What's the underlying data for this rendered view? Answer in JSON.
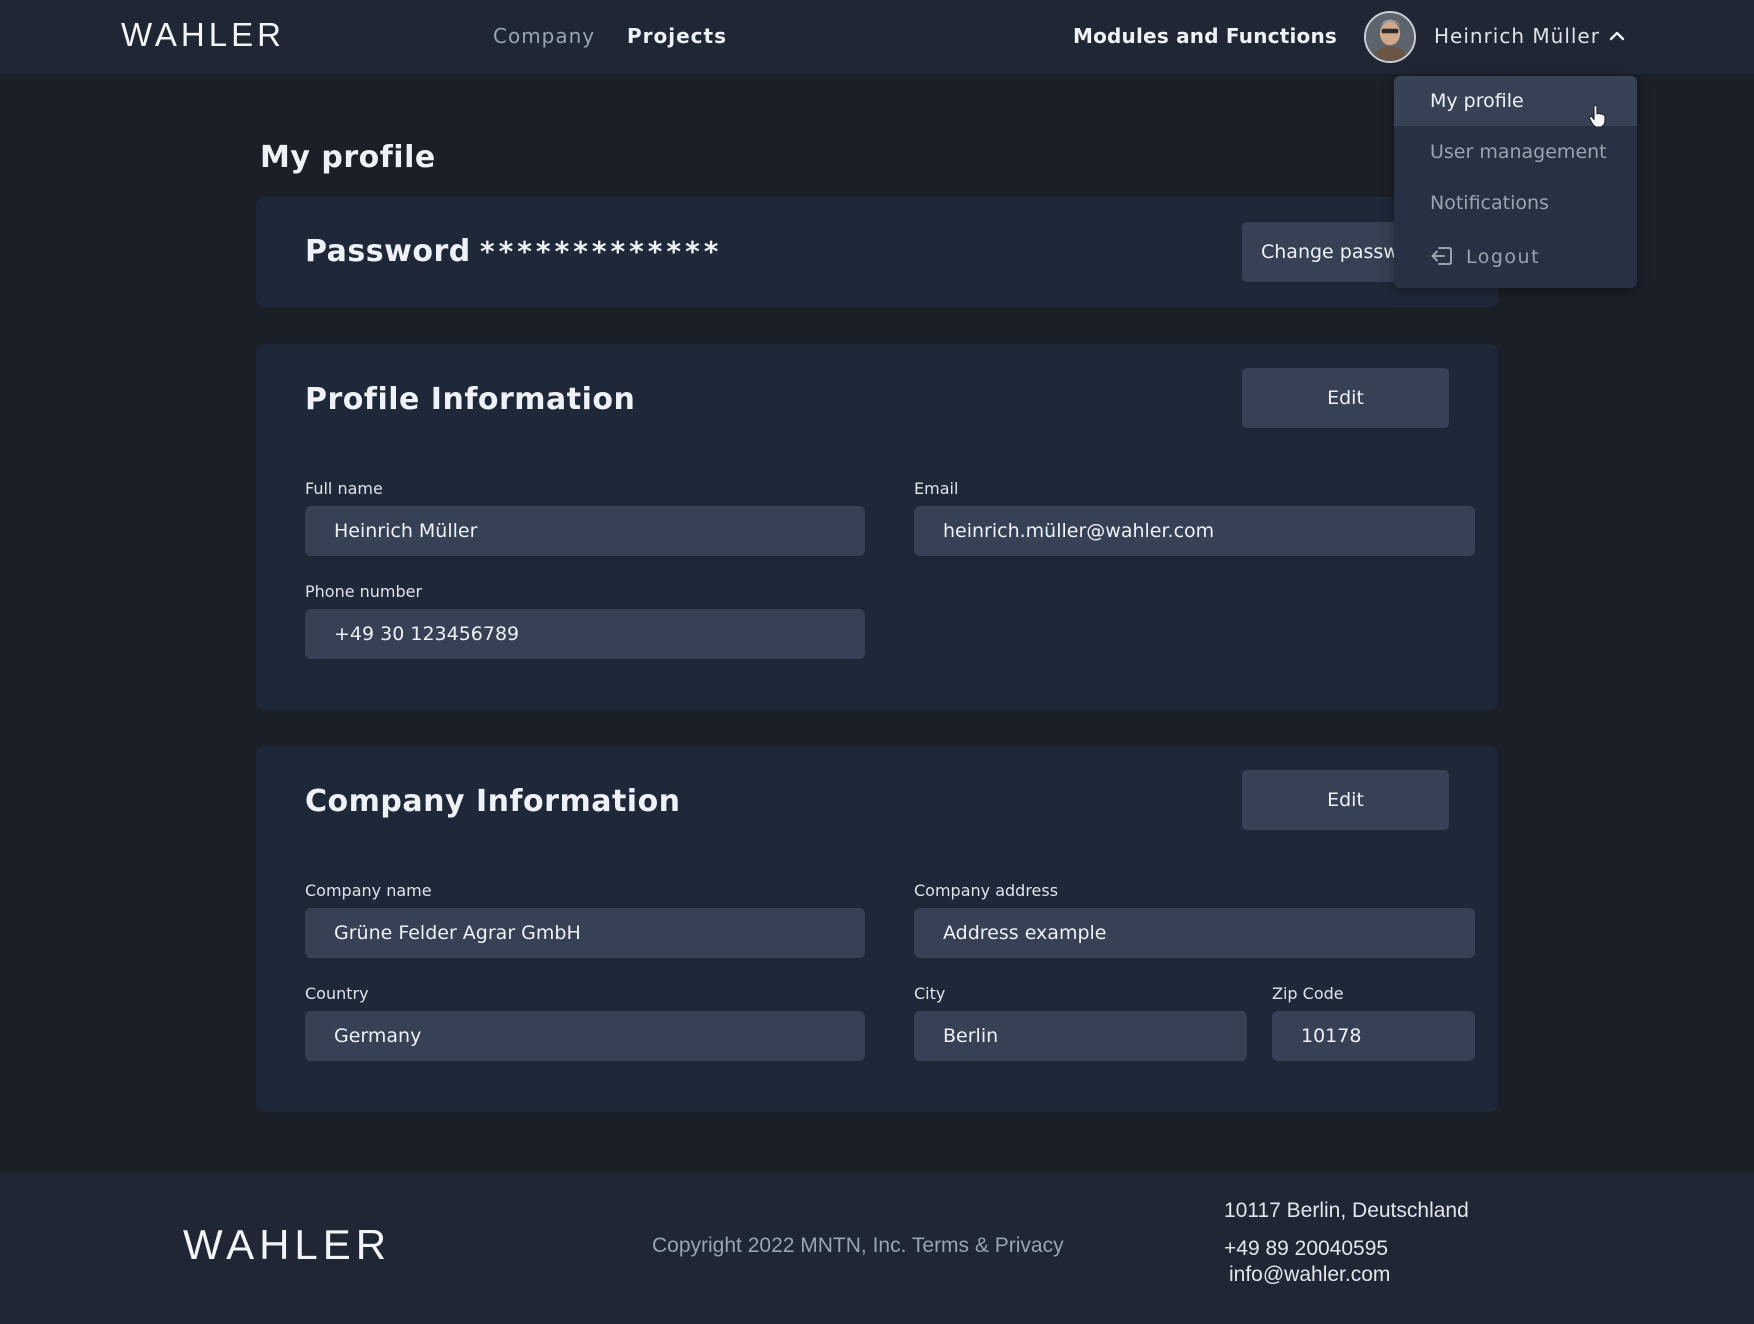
{
  "header": {
    "logo": "WAHLER",
    "nav": {
      "company": "Company",
      "projects": "Projects",
      "modules": "Modules and Functions"
    },
    "user_name": "Heinrich Müller"
  },
  "dropdown": {
    "my_profile": "My profile",
    "user_management": "User management",
    "notifications": "Notifications",
    "logout": "Logout"
  },
  "page": {
    "title": "My profile"
  },
  "password": {
    "title": "Password",
    "masked": "*************",
    "change_button": "Change passw"
  },
  "profile_info": {
    "title": "Profile Information",
    "edit_button": "Edit",
    "full_name_label": "Full name",
    "full_name": "Heinrich Müller",
    "email_label": "Email",
    "email": "heinrich.müller@wahler.com",
    "phone_label": "Phone number",
    "phone": "+49 30 123456789"
  },
  "company_info": {
    "title": "Company Information",
    "edit_button": "Edit",
    "company_name_label": "Company name",
    "company_name": "Grüne Felder Agrar GmbH",
    "address_label": "Company address",
    "address": "Address example",
    "country_label": "Country",
    "country": "Germany",
    "city_label": "City",
    "city": "Berlin",
    "zip_label": "Zip Code",
    "zip": "10178"
  },
  "footer": {
    "logo": "WAHLER",
    "copyright": "Copyright 2022 MNTN, Inc. Terms & Privacy",
    "address": "10117 Berlin, Deutschland",
    "phone": "+49 89 20040595",
    "email": "info@wahler.com"
  },
  "icons": {
    "chevron": "chevron-up-icon",
    "logout": "logout-icon",
    "cursor": "hand-pointer-icon"
  },
  "colors": {
    "background": "#1b1f27",
    "header": "#1f2735",
    "card": "#1f2838",
    "input": "#364155",
    "dropdown": "#283143",
    "dropdown_active": "#374257"
  }
}
